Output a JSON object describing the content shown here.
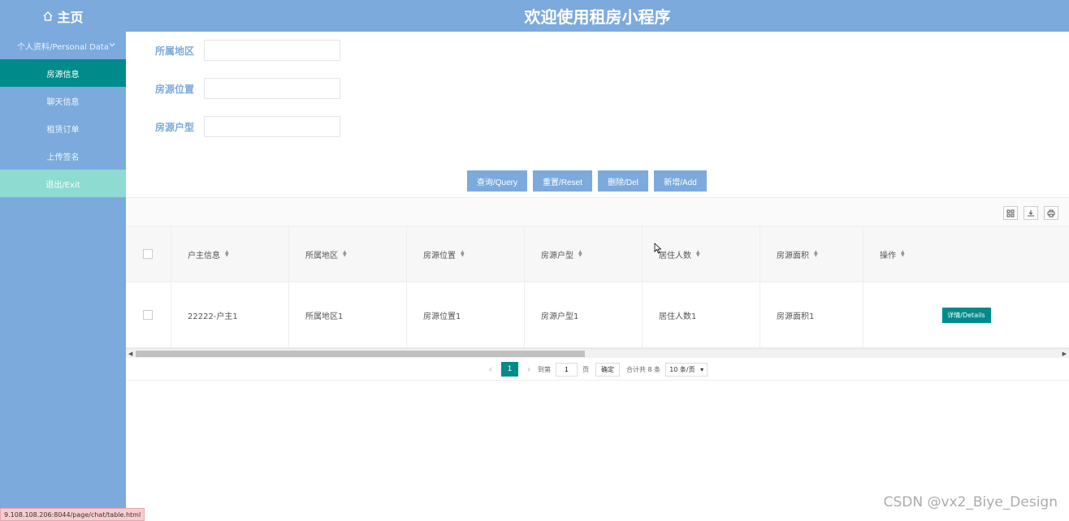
{
  "header": {
    "home_label": "主页",
    "title": "欢迎使用租房小程序"
  },
  "sidebar": {
    "group_label": "个人资料/Personal Data",
    "items": [
      {
        "label": "房源信息",
        "state": "active"
      },
      {
        "label": "聊天信息",
        "state": "normal"
      },
      {
        "label": "租赁订单",
        "state": "normal"
      },
      {
        "label": "上传签名",
        "state": "normal"
      },
      {
        "label": "退出/Exit",
        "state": "exit"
      }
    ]
  },
  "search": {
    "region_label": "所属地区",
    "region_value": "",
    "location_label": "房源位置",
    "location_value": "",
    "layout_label": "房源户型",
    "layout_value": ""
  },
  "actions": {
    "query": "查询/Query",
    "reset": "重置/Reset",
    "delete": "删除/Del",
    "add": "新增/Add"
  },
  "table": {
    "columns": [
      "户主信息",
      "所属地区",
      "房源位置",
      "房源户型",
      "居住人数",
      "房源面积",
      "操作"
    ],
    "rows": [
      {
        "owner": "22222-户主1",
        "region": "所属地区1",
        "location": "房源位置1",
        "layout": "房源户型1",
        "residents": "居住人数1",
        "area": "房源面积1",
        "action": "详情/Details"
      }
    ]
  },
  "pagination": {
    "current_page": "1",
    "goto_label": "到第",
    "goto_value": "1",
    "page_unit": "页",
    "confirm": "确定",
    "total": "合计共 8 条",
    "page_size": "10 条/页"
  },
  "status_url": "9.108.108.206:8044/page/chat/table.html",
  "watermark": "CSDN @vx2_Biye_Design",
  "colors": {
    "primary": "#7caadc",
    "accent": "#008b8b",
    "exit": "#8ddbd1"
  }
}
